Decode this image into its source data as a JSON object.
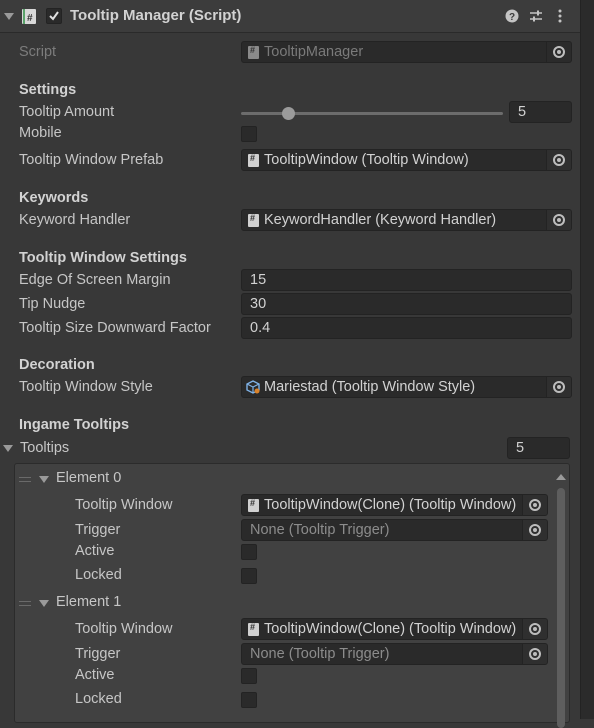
{
  "component": {
    "title": "Tooltip Manager (Script)",
    "enabled": true,
    "script_label": "Script",
    "script_value": "TooltipManager"
  },
  "settings": {
    "header": "Settings",
    "tooltip_amount_label": "Tooltip Amount",
    "tooltip_amount_value": "5",
    "tooltip_amount_fraction": 0.18,
    "mobile_label": "Mobile",
    "mobile_checked": false,
    "prefab_label": "Tooltip Window Prefab",
    "prefab_value": "TooltipWindow (Tooltip Window)"
  },
  "keywords": {
    "header": "Keywords",
    "handler_label": "Keyword Handler",
    "handler_value": "KeywordHandler (Keyword Handler)"
  },
  "window_settings": {
    "header": "Tooltip Window Settings",
    "edge_label": "Edge Of Screen Margin",
    "edge_value": "15",
    "nudge_label": "Tip Nudge",
    "nudge_value": "30",
    "size_label": "Tooltip Size Downward Factor",
    "size_value": "0.4"
  },
  "decoration": {
    "header": "Decoration",
    "style_label": "Tooltip Window Style",
    "style_value": "Mariestad (Tooltip Window Style)"
  },
  "ingame": {
    "header": "Ingame Tooltips",
    "list_label": "Tooltips",
    "list_count": "5",
    "elements": [
      {
        "name": "Element 0",
        "window_label": "Tooltip Window",
        "window_value": "TooltipWindow(Clone) (Tooltip Window)",
        "trigger_label": "Trigger",
        "trigger_value": "None (Tooltip Trigger)",
        "active_label": "Active",
        "locked_label": "Locked"
      },
      {
        "name": "Element 1",
        "window_label": "Tooltip Window",
        "window_value": "TooltipWindow(Clone) (Tooltip Window)",
        "trigger_label": "Trigger",
        "trigger_value": "None (Tooltip Trigger)",
        "active_label": "Active",
        "locked_label": "Locked"
      }
    ]
  },
  "icons": {
    "help": "help-icon",
    "presets": "presets-icon",
    "menu": "kebab-menu-icon"
  }
}
